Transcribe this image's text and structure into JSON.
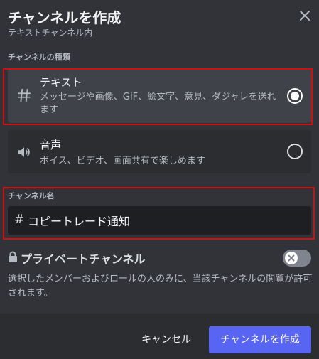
{
  "header": {
    "title": "チャンネルを作成",
    "subtitle": "テキストチャンネル内",
    "close_icon": "close-icon"
  },
  "channel_type": {
    "section_label": "チャンネルの種類",
    "options": [
      {
        "icon": "hash-icon",
        "title": "テキスト",
        "description": "メッセージや画像、GIF、絵文字、意見、ダジャレを送れます",
        "selected": true
      },
      {
        "icon": "speaker-icon",
        "title": "音声",
        "description": "ボイス、ビデオ、画面共有で楽しめます",
        "selected": false
      }
    ]
  },
  "channel_name": {
    "section_label": "チャンネル名",
    "prefix": "#",
    "value": "コピートレード通知"
  },
  "private": {
    "icon": "lock-icon",
    "label": "プライベートチャンネル",
    "enabled": false,
    "description": "選択したメンバーおよびロールの人のみに、当該チャンネルの閲覧が許可されます。"
  },
  "footer": {
    "cancel_label": "キャンセル",
    "create_label": "チャンネルを作成"
  },
  "colors": {
    "background": "#313338",
    "footer": "#2b2d31",
    "accent": "#5865f2",
    "highlight_border": "#d20f0f"
  }
}
